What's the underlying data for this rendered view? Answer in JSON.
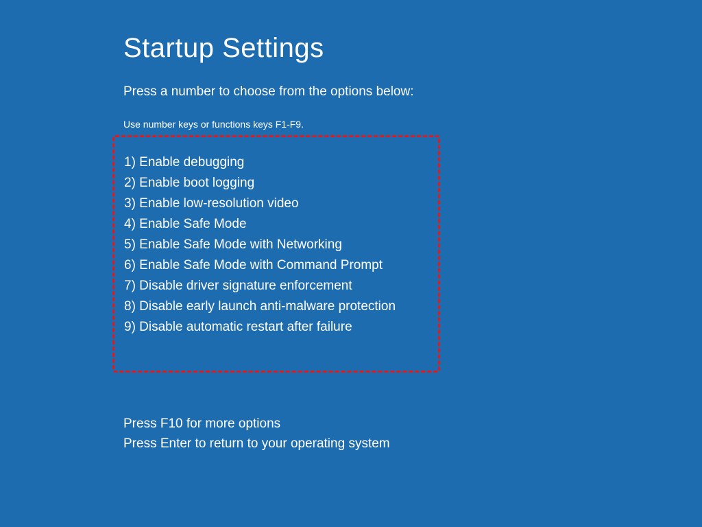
{
  "title": "Startup Settings",
  "subtitle": "Press a number to choose from the options below:",
  "hint": "Use number keys or functions keys F1-F9.",
  "options": [
    "1) Enable debugging",
    "2) Enable boot logging",
    "3) Enable low-resolution video",
    "4) Enable Safe Mode",
    "5) Enable Safe Mode with Networking",
    "6) Enable Safe Mode with Command Prompt",
    "7) Disable driver signature enforcement",
    "8) Disable early launch anti-malware protection",
    "9) Disable automatic restart after failure"
  ],
  "footer": {
    "more_options": "Press F10 for more options",
    "return_line": "Press Enter to return to your operating system"
  }
}
